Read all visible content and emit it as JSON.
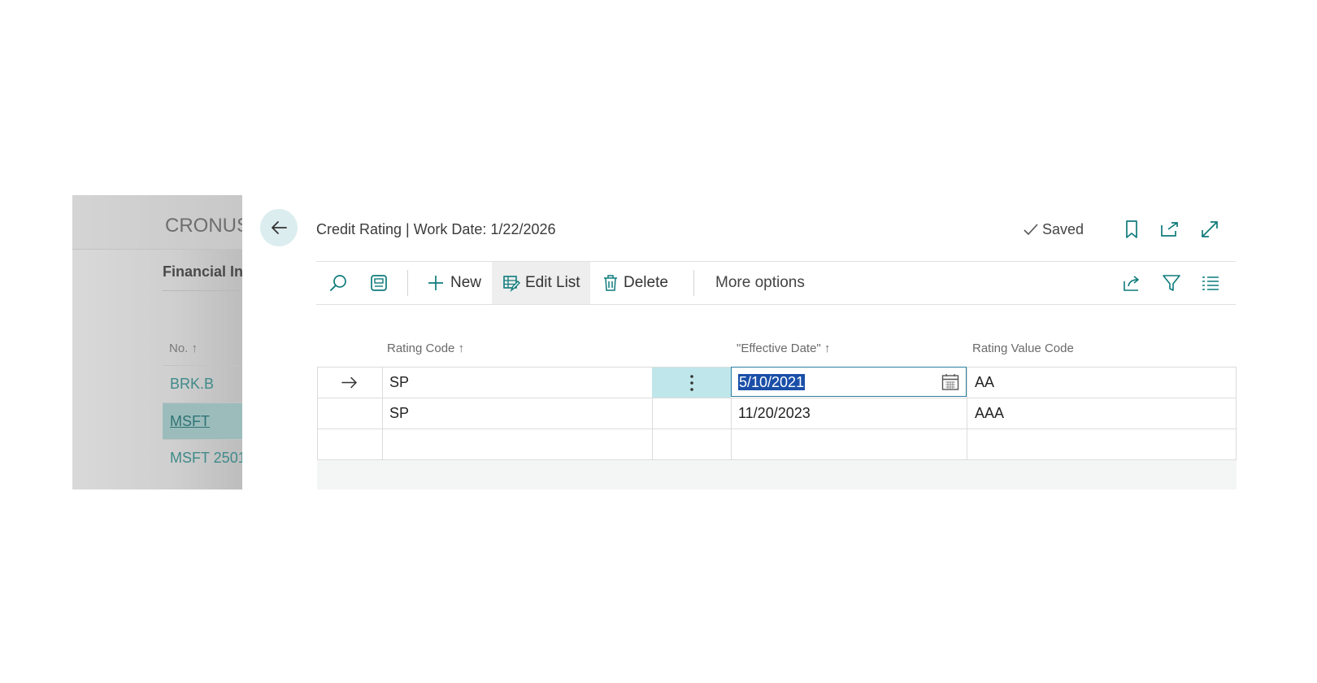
{
  "background_page": {
    "company": "CRONUS",
    "section_title": "Financial In",
    "column_header": "No. ↑",
    "rows": [
      "BRK.B",
      "MSFT",
      "MSFT 2501"
    ],
    "selected_row": "MSFT"
  },
  "dialog": {
    "title": "Credit Rating | Work Date: 1/22/2026",
    "saved_label": "Saved"
  },
  "actionbar": {
    "new_label": "New",
    "edit_list_label": "Edit List",
    "delete_label": "Delete",
    "more_options_label": "More options"
  },
  "grid": {
    "columns": {
      "rating_code": "Rating Code ↑",
      "effective_date": "\"Effective Date\" ↑",
      "rating_value_code": "Rating Value Code"
    },
    "rows": [
      {
        "rating_code": "SP",
        "effective_date": "5/10/2021",
        "rating_value_code": "AA"
      },
      {
        "rating_code": "SP",
        "effective_date": "11/20/2023",
        "rating_value_code": "AAA"
      }
    ]
  },
  "colors": {
    "accent": "#0f7b7b",
    "selection": "#1a4fa8",
    "active_cell": "#bfe6ea"
  }
}
